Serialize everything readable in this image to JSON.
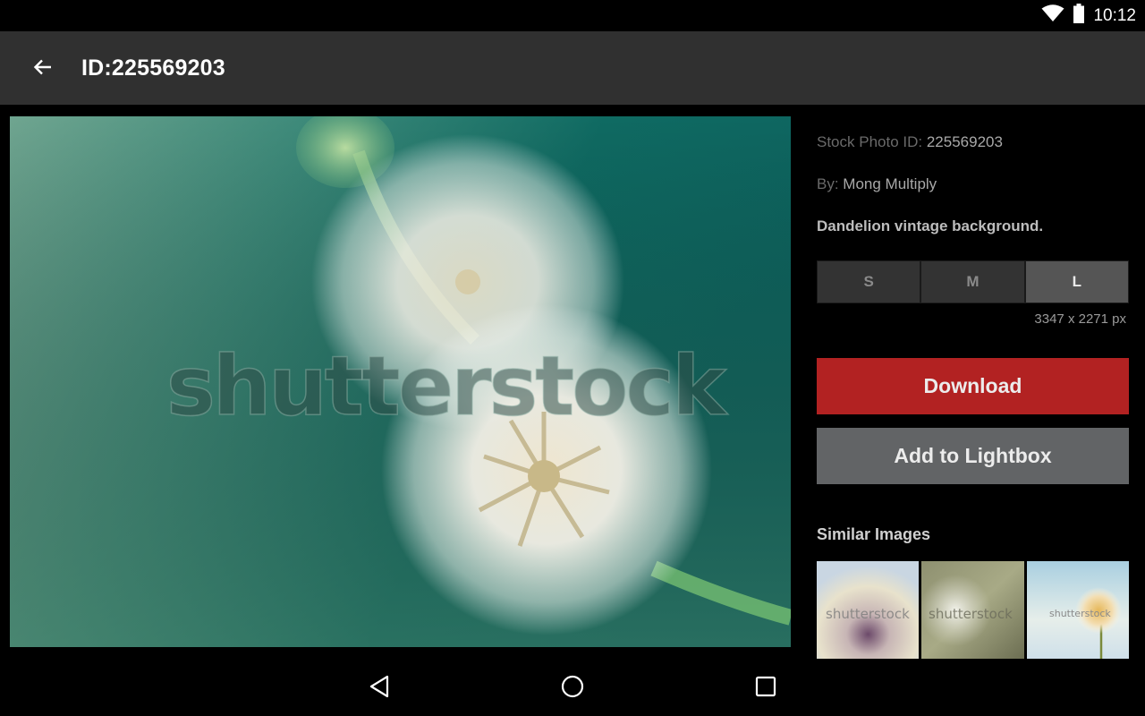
{
  "status_bar": {
    "time": "10:12",
    "icons": [
      "wifi-icon",
      "battery-icon"
    ]
  },
  "app_bar": {
    "back_icon": "arrow-left-icon",
    "title": "ID:225569203"
  },
  "main_image": {
    "alt": "Dandelion vintage background.",
    "watermark": "shutterstock"
  },
  "details": {
    "stock_id_label": "Stock Photo ID: ",
    "stock_id_value": "225569203",
    "by_label": "By: ",
    "by_value": "Mong Multiply",
    "description": "Dandelion vintage background.",
    "sizes": [
      {
        "label": "S",
        "selected": false
      },
      {
        "label": "M",
        "selected": false
      },
      {
        "label": "L",
        "selected": true
      }
    ],
    "dimensions": "3347 x 2271 px",
    "download_label": "Download",
    "lightbox_label": "Add to Lightbox",
    "similar_title": "Similar Images",
    "similar_images": [
      {
        "watermark": "shutterstock"
      },
      {
        "watermark": "shutterstock"
      },
      {
        "watermark": "shutterstock"
      }
    ]
  },
  "colors": {
    "download": "#b22222",
    "lightbox": "#626466",
    "app_bar": "#303030"
  },
  "nav_bar": {
    "back": "nav-back-icon",
    "home": "nav-home-icon",
    "recents": "nav-recents-icon"
  }
}
